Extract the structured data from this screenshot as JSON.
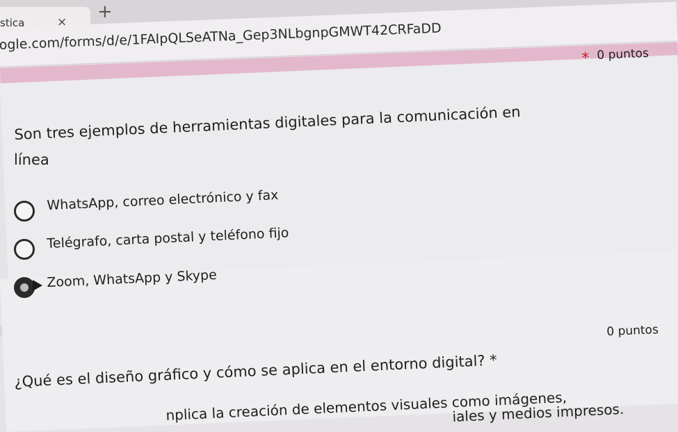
{
  "browser": {
    "tab_title": "stica",
    "tab_close": "×",
    "new_tab": "+",
    "url": "ogle.com/forms/d/e/1FAIpQLSeATNa_Gep3NLbgnpGMWT42CRFaDD"
  },
  "questions": [
    {
      "points": "0 puntos",
      "required_mark": "*",
      "text_line1": "Son tres ejemplos de herramientas digitales para la comunicación en",
      "text_line2": "línea",
      "options": [
        {
          "label": "WhatsApp, correo electrónico y fax",
          "selected": false
        },
        {
          "label": "Telégrafo, carta postal y teléfono fijo",
          "selected": false
        },
        {
          "label": "Zoom, WhatsApp y Skype",
          "selected": true
        }
      ]
    },
    {
      "points": "0 puntos",
      "text": "¿Qué es el diseño gráfico y cómo se aplica en el entorno digital? *",
      "answer_line1": "nplica la creación de elementos visuales como imágenes,",
      "answer_line2": "iales y medios impresos."
    }
  ]
}
